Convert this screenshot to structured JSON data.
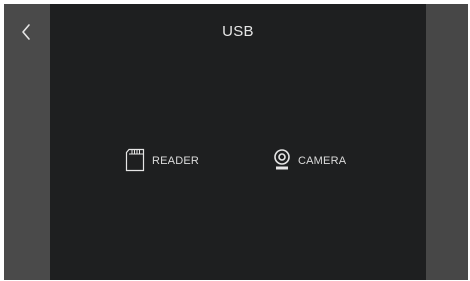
{
  "header": {
    "title": "USB"
  },
  "nav": {
    "back_icon": "chevron-left-icon"
  },
  "options": [
    {
      "label": "READER",
      "icon": "sd-card-icon"
    },
    {
      "label": "CAMERA",
      "icon": "webcam-icon"
    }
  ],
  "colors": {
    "panel_background": "#1e1f20",
    "side_rail": "#474747",
    "text": "#e6e6e6"
  }
}
